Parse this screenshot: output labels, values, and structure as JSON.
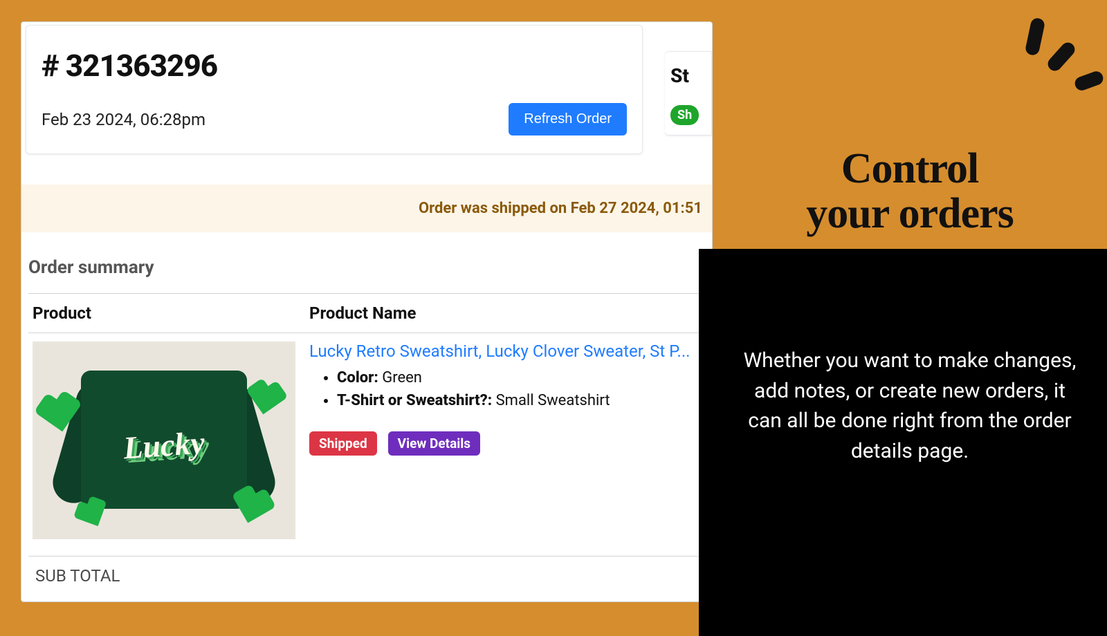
{
  "order": {
    "number_label": "# 321363296",
    "date": "Feb 23 2024, 06:28pm",
    "refresh_label": "Refresh Order"
  },
  "status_card": {
    "title": "St",
    "badge": "Sh"
  },
  "ship_banner": "Order was shipped on Feb 27 2024, 01:51",
  "summary": {
    "heading": "Order summary",
    "col_product": "Product",
    "col_name": "Product Name",
    "item": {
      "name_link": "Lucky Retro Sweatshirt, Lucky Clover Sweater, St P...",
      "lucky_text": "Lucky",
      "opt1_label": "Color:",
      "opt1_value": " Green",
      "opt2_label": "T-Shirt or Sweatshirt?:",
      "opt2_value": " Small Sweatshirt",
      "badge_shipped": "Shipped",
      "view_details": "View Details"
    },
    "subtotal_label": "SUB TOTAL"
  },
  "marketing": {
    "headline_l1": "Control",
    "headline_l2": "your orders",
    "subtext": "Whether you want to make changes, add notes, or create new orders, it can all be done right from the order details page."
  }
}
